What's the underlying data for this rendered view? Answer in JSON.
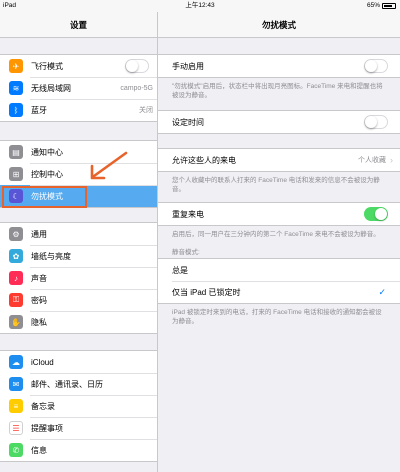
{
  "statusbar": {
    "carrier": "iPad",
    "time": "上午12:43",
    "battery": "65%"
  },
  "left": {
    "title": "设置",
    "groups": [
      [
        {
          "name": "airplane",
          "label": "飞行模式",
          "icon": "airplane-icon",
          "glyph": "✈",
          "color": "#ff9500",
          "toggle": false
        },
        {
          "name": "wifi",
          "label": "无线局域网",
          "value": "campo-5G",
          "icon": "wifi-icon",
          "glyph": "≋",
          "color": "#007aff"
        },
        {
          "name": "bluetooth",
          "label": "蓝牙",
          "value": "关闭",
          "icon": "bluetooth-icon",
          "glyph": "ᛒ",
          "color": "#007aff"
        }
      ],
      [
        {
          "name": "notification-center",
          "label": "通知中心",
          "icon": "notification-center-icon",
          "glyph": "▤",
          "color": "#8e8e93"
        },
        {
          "name": "control-center",
          "label": "控制中心",
          "icon": "control-center-icon",
          "glyph": "⊞",
          "color": "#8e8e93"
        },
        {
          "name": "do-not-disturb",
          "label": "勿扰模式",
          "icon": "moon-icon",
          "glyph": "☾",
          "color": "#5856d6",
          "selected": true
        }
      ],
      [
        {
          "name": "general",
          "label": "通用",
          "icon": "gear-icon",
          "glyph": "⚙",
          "color": "#8e8e93"
        },
        {
          "name": "wallpaper",
          "label": "墙纸与亮度",
          "icon": "wallpaper-icon",
          "glyph": "✿",
          "color": "#34aadc"
        },
        {
          "name": "sounds",
          "label": "声音",
          "icon": "speaker-icon",
          "glyph": "♪",
          "color": "#ff2d55"
        },
        {
          "name": "passcode",
          "label": "密码",
          "icon": "lock-icon",
          "glyph": "⚿",
          "color": "#ff3b30"
        },
        {
          "name": "privacy",
          "label": "隐私",
          "icon": "hand-icon",
          "glyph": "✋",
          "color": "#8e8e93"
        }
      ],
      [
        {
          "name": "icloud",
          "label": "iCloud",
          "icon": "cloud-icon",
          "glyph": "☁",
          "color": "#1d8df0"
        },
        {
          "name": "mail",
          "label": "邮件、通讯录、日历",
          "icon": "mail-icon",
          "glyph": "✉",
          "color": "#1d8df0"
        },
        {
          "name": "notes",
          "label": "备忘录",
          "icon": "notes-icon",
          "glyph": "≡",
          "color": "#ffcc00"
        },
        {
          "name": "reminders",
          "label": "提醒事项",
          "icon": "reminders-icon",
          "glyph": "☰",
          "color": "#ffffff"
        },
        {
          "name": "messages",
          "label": "信息",
          "icon": "messages-icon",
          "glyph": "✆",
          "color": "#4cd964"
        }
      ]
    ]
  },
  "right": {
    "title": "勿扰模式",
    "manual": {
      "label": "手动启用",
      "on": false,
      "note": "\"勿扰模式\"启用后，状态栏中将出现月亮图标。FaceTime 来电和提醒也将被设为静音。"
    },
    "scheduled": {
      "label": "设定时间",
      "on": false
    },
    "allow_calls": {
      "label": "允许这些人的来电",
      "value": "个人收藏",
      "note": "您个人收藏中的联系人打来的 FaceTime 电话和发来的信息不会被设为静音。"
    },
    "repeat": {
      "label": "重复来电",
      "on": true,
      "note": "启用后，同一用户在三分钟内的第二个 FaceTime 来电不会被设为静音。"
    },
    "silence": {
      "header": "静音模式:",
      "options": [
        {
          "label": "总是",
          "checked": false
        },
        {
          "label": "仅当 iPad 已锁定时",
          "checked": true
        }
      ],
      "note": "iPad 被锁定时来到的电话，打来的 FaceTime 电话和接收的通知都会被设为静音。"
    }
  }
}
